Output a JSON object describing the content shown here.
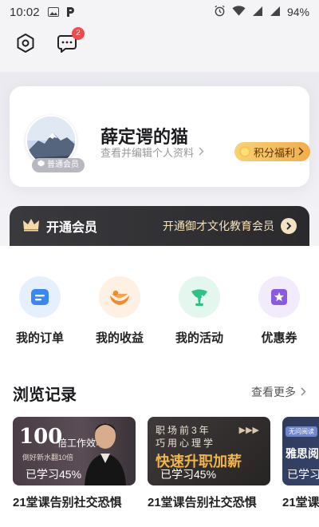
{
  "status_bar": {
    "time": "10:02",
    "battery": "94%"
  },
  "top_bar": {
    "message_badge": "2"
  },
  "profile": {
    "name": "薛定谔的猫",
    "edit_text": "查看并编辑个人资料",
    "member_tag": "普通会员",
    "points_button": "积分福利"
  },
  "vip": {
    "title": "开通会员",
    "subtitle": "开通御才文化教育会员"
  },
  "quick_actions": [
    {
      "label": "我的订单",
      "icon": "order-icon"
    },
    {
      "label": "我的收益",
      "icon": "earnings-icon"
    },
    {
      "label": "我的活动",
      "icon": "activity-icon"
    },
    {
      "label": "优惠券",
      "icon": "coupon-icon"
    }
  ],
  "history": {
    "title": "浏览记录",
    "see_more": "查看更多",
    "courses": [
      {
        "progress": "已学习45%",
        "title": "21堂课告别社交恐惧",
        "thumb_big": "100",
        "thumb_line1": "倍工作效率",
        "thumb_line2": "倒好新水翻10倍"
      },
      {
        "progress": "已学习45%",
        "title": "21堂课告别社交恐惧",
        "thumb_line1": "职场前3年",
        "thumb_line2": "巧用心理学",
        "thumb_big": "快速升职加薪"
      },
      {
        "progress": "已学习",
        "title": "21堂课",
        "thumb_tag": "无问阅读",
        "thumb_big": "雅思阅读"
      }
    ]
  },
  "colors": {
    "accent_gold": "#f2ad4b",
    "badge_red": "#f04b4b",
    "vip_bg": "#2f2f33"
  }
}
